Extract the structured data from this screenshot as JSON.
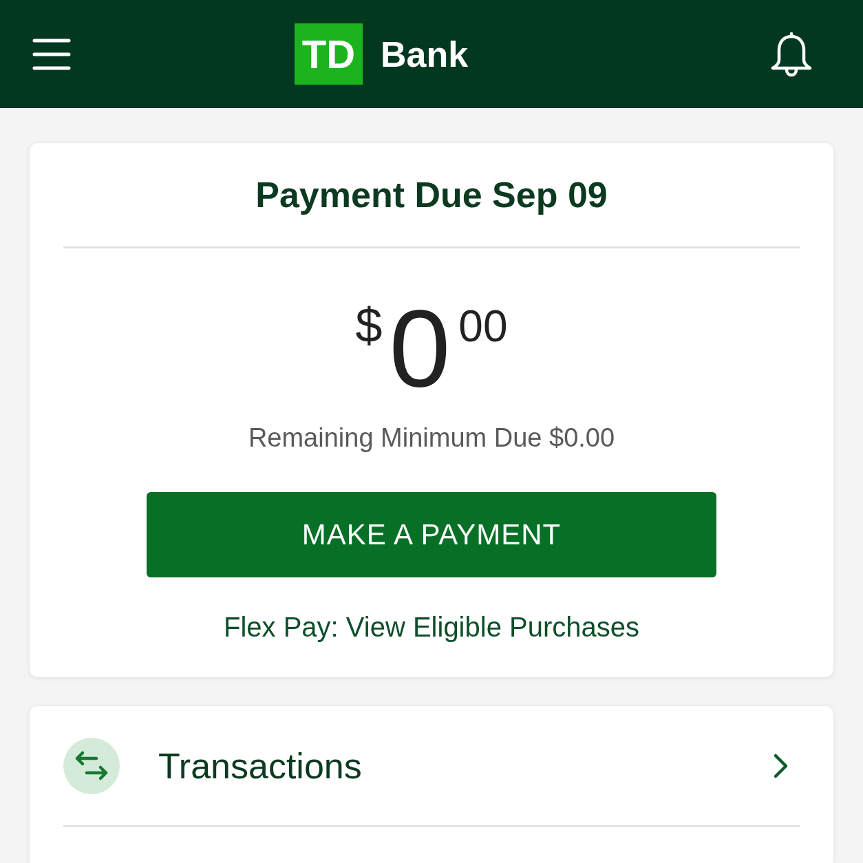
{
  "header": {
    "logo_mark": "TD",
    "logo_text": "Bank"
  },
  "payment_card": {
    "title": "Payment Due Sep 09",
    "amount": {
      "currency": "$",
      "whole": "0",
      "cents": "00"
    },
    "remaining": "Remaining Minimum Due $0.00",
    "button": "MAKE A PAYMENT",
    "link": "Flex Pay: View Eligible Purchases"
  },
  "menu": [
    {
      "label": "Transactions",
      "kind": "transactions"
    }
  ]
}
